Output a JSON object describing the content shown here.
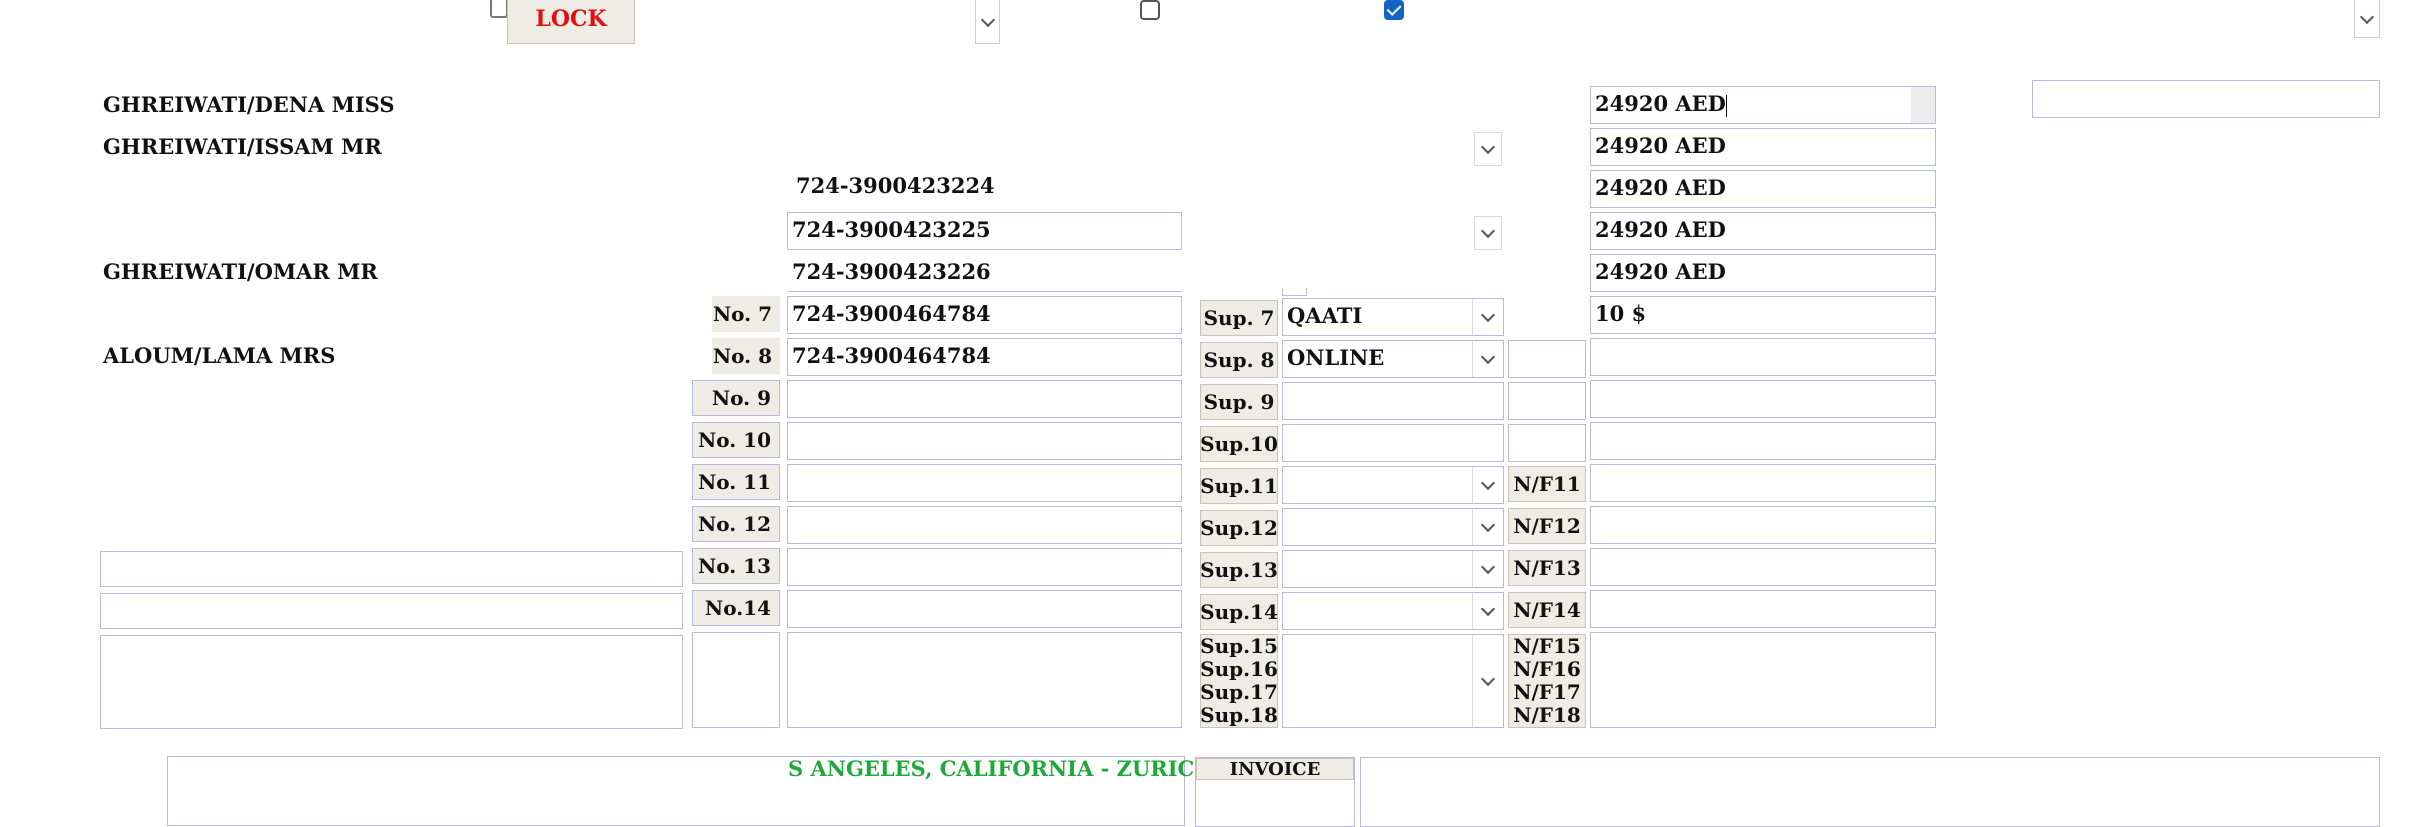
{
  "toolbar": {
    "lock_label": "LOCK",
    "checkbox_1_checked": false,
    "checkbox_2_checked": true
  },
  "passengers": [
    {
      "name": "GHREIWATI/DENA MISS"
    },
    {
      "name": "GHREIWATI/ISSAM MR"
    },
    {
      "name": "GHREIWATI/OMAR MR"
    },
    {
      "name": "ALOUM/LAMA MRS"
    }
  ],
  "tickets": {
    "t1": "724-3900423224",
    "t2": "724-3900423225",
    "t3": "724-3900423226",
    "t4": "724-3900464784",
    "t5": "724-3900464784"
  },
  "ticket_labels": {
    "no7": "No. 7",
    "no8": "No. 8",
    "no9": "No. 9",
    "no10": "No. 10",
    "no11": "No. 11",
    "no12": "No. 12",
    "no13": "No. 13",
    "no14": "No.14"
  },
  "suppliers": {
    "sup7": "Sup. 7",
    "sup8": "Sup. 8",
    "sup9": "Sup. 9",
    "sup10": "Sup.10",
    "sup11": "Sup.11",
    "sup12": "Sup.12",
    "sup13": "Sup.13",
    "sup14": "Sup.14",
    "sup15": "Sup.15",
    "sup16": "Sup.16",
    "sup17": "Sup.17",
    "sup18": "Sup.18",
    "sup7_value": "QAATI",
    "sup8_value": "ONLINE"
  },
  "nf_labels": {
    "nf11": "N/F11",
    "nf12": "N/F12",
    "nf13": "N/F13",
    "nf14": "N/F14",
    "nf15": "N/F15",
    "nf16": "N/F16",
    "nf17": "N/F17",
    "nf18": "N/F18"
  },
  "fares": {
    "f1": "24920 AED",
    "f2": "24920 AED",
    "f3": "24920 AED",
    "f4": "24920 AED",
    "f5": "24920 AED",
    "f6": "10 $"
  },
  "route_text": "S ANGELES, CALIFORNIA - ZURICH -",
  "invoice_label": "INVOICE",
  "colors": {
    "lock_text": "#e01010",
    "route_text": "#1fa83a",
    "checkbox_checked": "#1463c4"
  }
}
